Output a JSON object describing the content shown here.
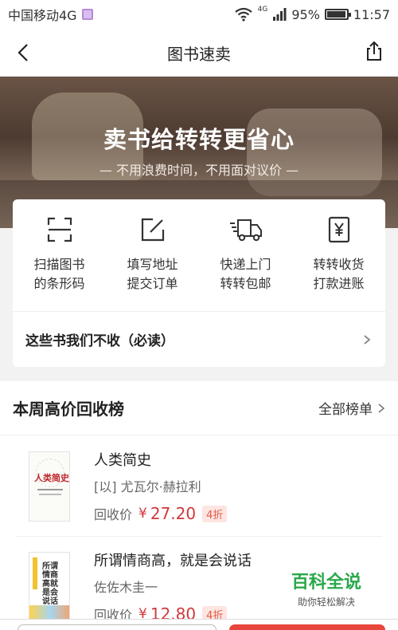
{
  "status_bar": {
    "carrier": "中国移动4G",
    "signal": "4G",
    "battery": "95%",
    "time": "11:57"
  },
  "header": {
    "title": "图书速卖"
  },
  "banner": {
    "headline": "卖书给转转更省心",
    "subtitle": "— 不用浪费时间，不用面对议价 —"
  },
  "steps": [
    {
      "icon": "scan-icon",
      "line1": "扫描图书",
      "line2": "的条形码"
    },
    {
      "icon": "edit-icon",
      "line1": "填写地址",
      "line2": "提交订单"
    },
    {
      "icon": "truck-icon",
      "line1": "快递上门",
      "line2": "转转包邮"
    },
    {
      "icon": "yen-icon",
      "line1": "转转收货",
      "line2": "打款进账"
    }
  ],
  "notice": {
    "text": "这些书我们不收（必读）"
  },
  "ranking": {
    "title": "本周高价回收榜",
    "all_label": "全部榜单",
    "price_label": "回收价",
    "currency": "¥",
    "books": [
      {
        "name": "人类简史",
        "author": "[以] 尤瓦尔·赫拉利",
        "price": "27.20",
        "discount": "4折",
        "cover_title": "人类简史"
      },
      {
        "name": "所谓情商高，就是会说话",
        "author": "佐佐木圭一",
        "price": "12.80",
        "discount": "4折",
        "cover_title": "所谓情商高就是会说话"
      }
    ]
  },
  "watermark": {
    "title": "百科全说",
    "slogan": "助你轻松解决"
  },
  "colors": {
    "accent": "#d0383c",
    "discount_bg": "#fde5e1",
    "watermark": "#2aa84a"
  }
}
